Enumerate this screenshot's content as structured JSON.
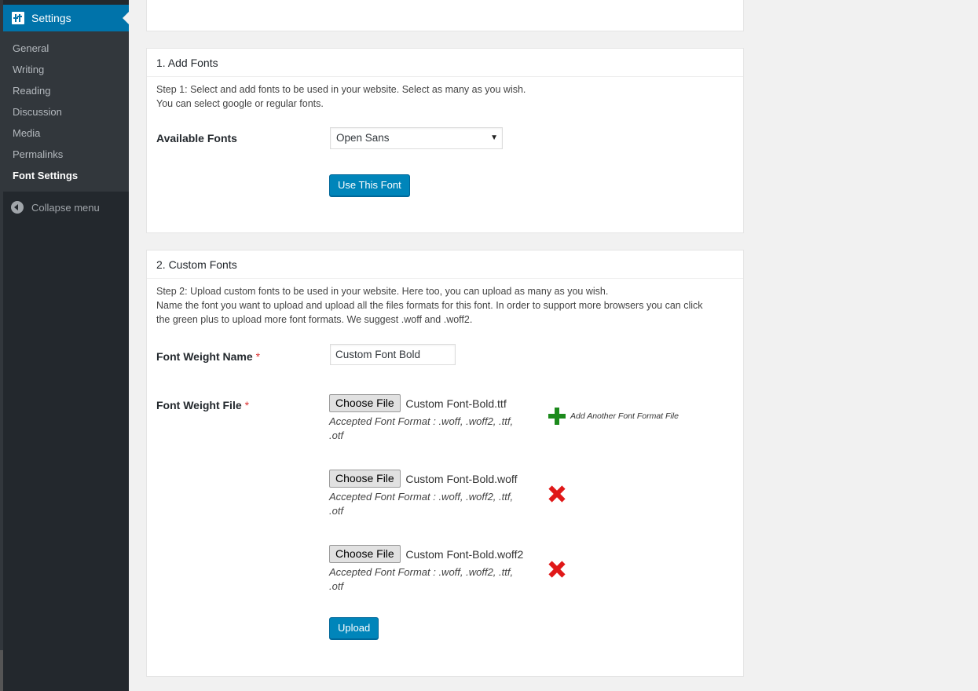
{
  "sidebar": {
    "header_label": "Settings",
    "items": [
      {
        "label": "General"
      },
      {
        "label": "Writing"
      },
      {
        "label": "Reading"
      },
      {
        "label": "Discussion"
      },
      {
        "label": "Media"
      },
      {
        "label": "Permalinks"
      },
      {
        "label": "Font Settings",
        "current": true
      }
    ],
    "collapse_label": "Collapse menu"
  },
  "add_fonts": {
    "title": "1. Add Fonts",
    "intro_line1": "Step 1: Select and add fonts to be used in your website. Select as many as you wish.",
    "intro_line2": "You can select google or regular fonts.",
    "available_label": "Available Fonts",
    "selected_font": "Open Sans",
    "use_button": "Use This Font"
  },
  "custom_fonts": {
    "title": "2. Custom Fonts",
    "intro_line1": "Step 2: Upload custom fonts to be used in your website. Here too, you can upload as many as you wish.",
    "intro_line2": "Name the font you want to upload and upload all the files formats for this font. In order to support more browsers you can click",
    "intro_line3": "the green plus to upload more font formats. We suggest .woff and .woff2.",
    "weight_name_label": "Font Weight Name",
    "weight_name_value": "Custom Font Bold",
    "weight_file_label": "Font Weight File",
    "required_mark": "*",
    "choose_file_label": "Choose File",
    "accepted_line1": "Accepted Font Format : .woff, .woff2, .ttf,",
    "accepted_line2": ".otf",
    "files": [
      {
        "name": "Custom Font-Bold.ttf"
      },
      {
        "name": "Custom Font-Bold.woff"
      },
      {
        "name": "Custom Font-Bold.woff2"
      }
    ],
    "add_another_label": "Add Another Font Format File",
    "upload_button": "Upload"
  },
  "colors": {
    "sidebar_bg": "#23282d",
    "accent": "#0073aa",
    "button_primary": "#0085ba",
    "plus_green": "#1c8a1c",
    "remove_red": "#e01818"
  },
  "icons": [
    "settings-icon",
    "collapse-arrow-icon",
    "dropdown-caret-icon",
    "plus-icon",
    "remove-icon"
  ]
}
